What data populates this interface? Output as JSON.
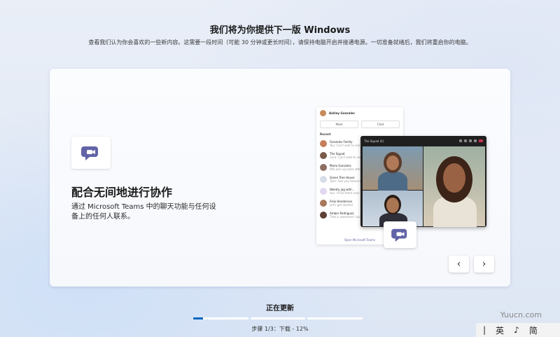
{
  "header": {
    "title": "我们将为你提供下一版 Windows",
    "subtitle": "查看我们认为你会喜欢的一些新内容。这需要一段时间（可能 30 分钟或更长时间），请保持电脑开启并接通电源。一切准备就绪后，我们将重启你的电脑。"
  },
  "feature": {
    "icon": "teams-chat-icon",
    "title": "配合无间地进行协作",
    "description": "通过 Microsoft Teams 中的聊天功能与任何设备上的任何人联系。"
  },
  "teams_mock": {
    "user_name": "Ashley Gonzales",
    "meet_label": "Meet",
    "chat_label": "Chat",
    "recent_label": "Recent",
    "contacts": [
      {
        "name": "Gonzales Family",
        "msg": "You: Can't wait to see you"
      },
      {
        "name": "The Squad",
        "msg": "Cora: Can't wait to see y..."
      },
      {
        "name": "Mario Gonzales",
        "msg": "Will pick up pizza after..."
      },
      {
        "name": "Green Tree House",
        "msg": "Tyler: See you tomorrow"
      },
      {
        "name": "Weekly jog with...",
        "msg": "You: I'll be there soon"
      },
      {
        "name": "Felix Henderson",
        "msg": "Let's get started"
      },
      {
        "name": "Amber Rodriguez",
        "msg": "That is awesome! Love it"
      }
    ],
    "footer": "Open Microsoft Teams",
    "call_title": "The Squad (4)"
  },
  "navigation": {
    "prev_label": "‹",
    "next_label": "›"
  },
  "status": {
    "label": "正在更新",
    "progress_percent": 12,
    "step_text": "步骤 1/3：下载 - 12%"
  },
  "ime": {
    "items": [
      "英",
      "♪",
      "简"
    ]
  },
  "watermark": "Yuucn.com",
  "colors": {
    "accent": "#0067c0",
    "teams_purple": "#6264a7"
  }
}
